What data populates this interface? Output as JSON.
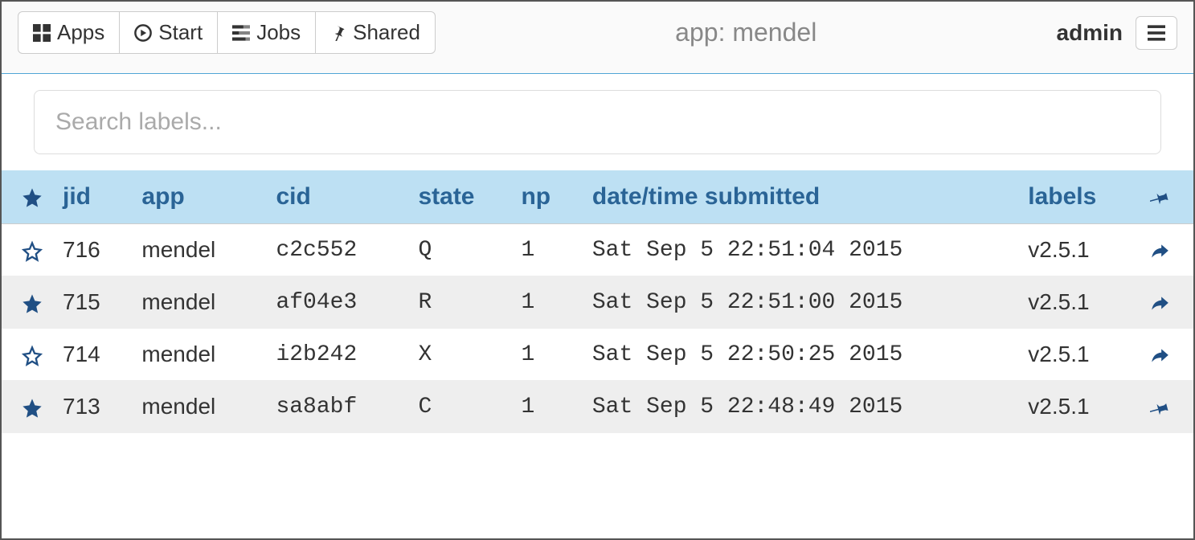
{
  "nav": {
    "apps_label": "Apps",
    "start_label": "Start",
    "jobs_label": "Jobs",
    "shared_label": "Shared"
  },
  "title_prefix": "app: ",
  "title_value": "mendel",
  "user": "admin",
  "search": {
    "placeholder": "Search labels..."
  },
  "columns": {
    "jid": "jid",
    "app": "app",
    "cid": "cid",
    "state": "state",
    "np": "np",
    "date": "date/time submitted",
    "labels": "labels"
  },
  "rows": [
    {
      "starred": false,
      "jid": "716",
      "app": "mendel",
      "cid": "c2c552",
      "state": "Q",
      "np": "1",
      "date": "Sat Sep 5 22:51:04 2015",
      "labels": "v2.5.1",
      "action": "share"
    },
    {
      "starred": true,
      "jid": "715",
      "app": "mendel",
      "cid": "af04e3",
      "state": "R",
      "np": "1",
      "date": "Sat Sep 5 22:51:00 2015",
      "labels": "v2.5.1",
      "action": "share"
    },
    {
      "starred": false,
      "jid": "714",
      "app": "mendel",
      "cid": "i2b242",
      "state": "X",
      "np": "1",
      "date": "Sat Sep 5 22:50:25 2015",
      "labels": "v2.5.1",
      "action": "share"
    },
    {
      "starred": true,
      "jid": "713",
      "app": "mendel",
      "cid": "sa8abf",
      "state": "C",
      "np": "1",
      "date": "Sat Sep 5 22:48:49 2015",
      "labels": "v2.5.1",
      "action": "pin"
    }
  ]
}
